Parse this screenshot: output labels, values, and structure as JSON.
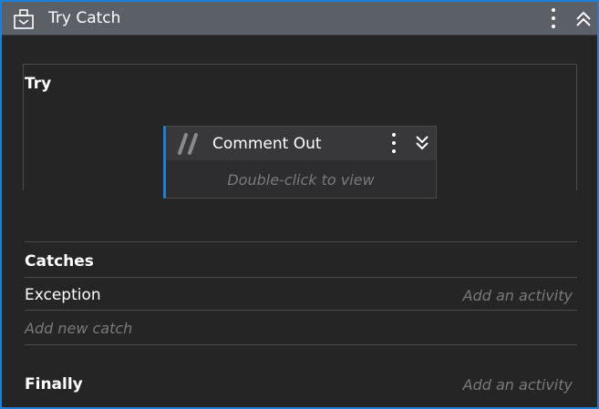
{
  "header": {
    "title": "Try Catch",
    "icon": "try-catch-icon"
  },
  "try": {
    "label": "Try",
    "activity": {
      "title": "Comment Out",
      "hint": "Double-click to view",
      "icon": "comment-out-icon"
    }
  },
  "catches": {
    "label": "Catches",
    "items": [
      {
        "exception": "Exception",
        "placeholder": "Add an activity"
      }
    ],
    "add_new": "Add new catch"
  },
  "finally": {
    "label": "Finally",
    "placeholder": "Add an activity"
  },
  "colors": {
    "accent": "#1e7fd6",
    "header_bg": "#5b5f66",
    "panel_bg": "#252526"
  }
}
